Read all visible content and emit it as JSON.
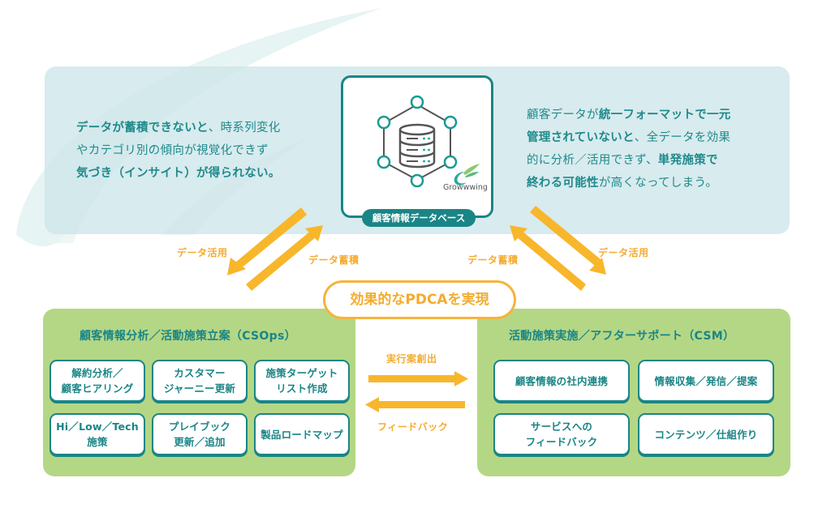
{
  "colors": {
    "teal": "#1a8586",
    "text_teal": "#1f8a8c",
    "orange": "#f5b43a",
    "green_panel": "#b4d785",
    "top_panel": "#d3e9eb"
  },
  "top": {
    "left_text": {
      "line1_bold": "データが蓄積できないと",
      "line1_rest": "、時系列変化",
      "line2": "やカテゴリ別の傾向が視覚化できず",
      "line3_bold": "気づき（インサイト）が得られない。"
    },
    "right_text": {
      "line1_normal": "顧客データが",
      "line1_bold": "統一フォーマットで一元",
      "line2_bold": "管理されていないと",
      "line2_rest": "、全データを効果",
      "line3_normal": "的に分析／活用できず、",
      "line3_bold": "単発施策で",
      "line4_bold": "終わる可能性",
      "line4_rest": "が高くなってしまう。"
    },
    "database": {
      "label": "顧客情報データベース",
      "icon": "database-network-icon",
      "brand": "Growwwing"
    }
  },
  "arrows": {
    "left_use": "データ活用",
    "left_store": "データ蓄積",
    "right_store": "データ蓄積",
    "right_use": "データ活用",
    "execute": "実行案創出",
    "feedback": "フィードバック"
  },
  "center_pill": "効果的なPDCAを実現",
  "left_panel": {
    "title": "顧客情報分析／活動施策立案（CSOps）",
    "items": [
      "解約分析／\n顧客ヒアリング",
      "カスタマー\nジャーニー更新",
      "施策ターゲット\nリスト作成",
      "Hi／Low／Tech\n施策",
      "プレイブック\n更新／追加",
      "製品ロードマップ"
    ]
  },
  "right_panel": {
    "title": "活動施策実施／アフターサポート（CSM）",
    "items": [
      "顧客情報の社内連携",
      "情報収集／発信／提案",
      "サービスへの\nフィードバック",
      "コンテンツ／仕組作り"
    ]
  }
}
